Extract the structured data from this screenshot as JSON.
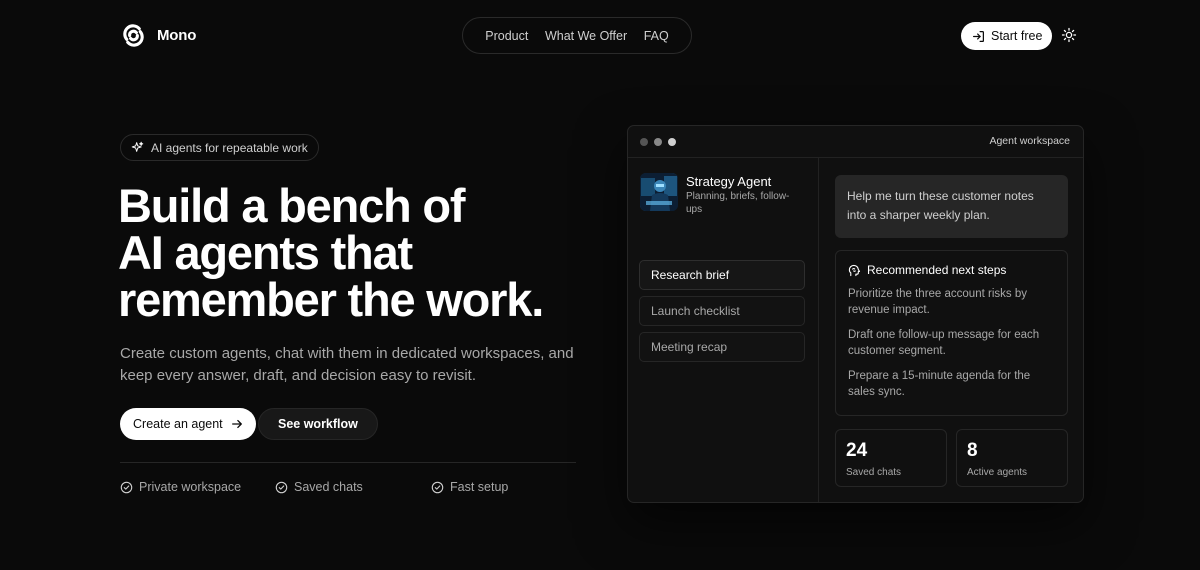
{
  "header": {
    "brand": "Mono",
    "nav": [
      "Product",
      "What We Offer",
      "FAQ"
    ],
    "start_label": "Start free"
  },
  "hero": {
    "badge": "AI agents for repeatable work",
    "title_lines": [
      "Build a bench of",
      "AI agents that",
      "remember the work."
    ],
    "subtitle": "Create custom agents, chat with them in dedicated workspaces, and keep every answer, draft, and decision easy to revisit.",
    "cta_primary": "Create an agent",
    "cta_secondary": "See workflow",
    "features": [
      "Private workspace",
      "Saved chats",
      "Fast setup"
    ]
  },
  "workspace": {
    "title": "Agent workspace",
    "agent": {
      "name": "Strategy Agent",
      "description": "Planning, briefs, follow-ups"
    },
    "chats": [
      "Research brief",
      "Launch checklist",
      "Meeting recap"
    ],
    "prompt": "Help me turn these customer notes into a sharper weekly plan.",
    "next_steps": {
      "heading": "Recommended next steps",
      "items": [
        "Prioritize the three account risks by revenue impact.",
        "Draft one follow-up message for each customer segment.",
        "Prepare a 15-minute agenda for the sales sync."
      ]
    },
    "stats": [
      {
        "value": "24",
        "label": "Saved chats"
      },
      {
        "value": "8",
        "label": "Active agents"
      }
    ]
  },
  "icons": {
    "logo": "mono-logo-icon",
    "start": "login-icon",
    "theme": "sun-icon",
    "badge": "sparkle-icon",
    "cta": "arrow-right-icon",
    "feature": "check-circle-icon",
    "next_steps": "brain-icon"
  },
  "colors": {
    "background": "#0a0a0a",
    "surface": "#101010",
    "border": "#262626",
    "text_primary": "#ffffff",
    "text_muted": "#a8a8a8",
    "button_light": "#ffffff"
  }
}
